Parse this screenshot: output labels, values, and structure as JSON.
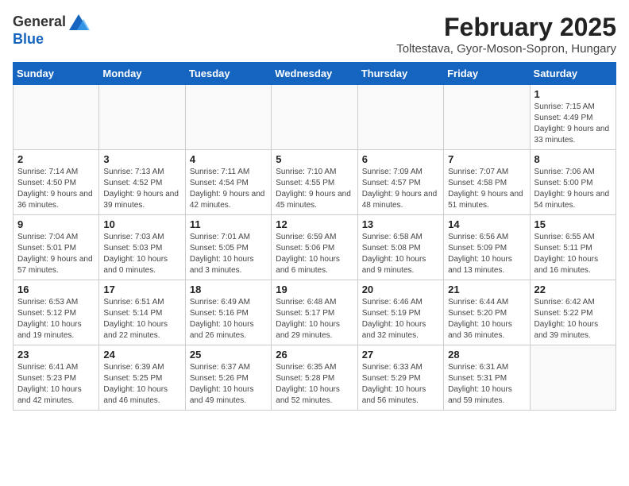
{
  "logo": {
    "general": "General",
    "blue": "Blue"
  },
  "header": {
    "month_year": "February 2025",
    "location": "Toltestava, Gyor-Moson-Sopron, Hungary"
  },
  "weekdays": [
    "Sunday",
    "Monday",
    "Tuesday",
    "Wednesday",
    "Thursday",
    "Friday",
    "Saturday"
  ],
  "weeks": [
    [
      {
        "day": "",
        "info": ""
      },
      {
        "day": "",
        "info": ""
      },
      {
        "day": "",
        "info": ""
      },
      {
        "day": "",
        "info": ""
      },
      {
        "day": "",
        "info": ""
      },
      {
        "day": "",
        "info": ""
      },
      {
        "day": "1",
        "info": "Sunrise: 7:15 AM\nSunset: 4:49 PM\nDaylight: 9 hours and 33 minutes."
      }
    ],
    [
      {
        "day": "2",
        "info": "Sunrise: 7:14 AM\nSunset: 4:50 PM\nDaylight: 9 hours and 36 minutes."
      },
      {
        "day": "3",
        "info": "Sunrise: 7:13 AM\nSunset: 4:52 PM\nDaylight: 9 hours and 39 minutes."
      },
      {
        "day": "4",
        "info": "Sunrise: 7:11 AM\nSunset: 4:54 PM\nDaylight: 9 hours and 42 minutes."
      },
      {
        "day": "5",
        "info": "Sunrise: 7:10 AM\nSunset: 4:55 PM\nDaylight: 9 hours and 45 minutes."
      },
      {
        "day": "6",
        "info": "Sunrise: 7:09 AM\nSunset: 4:57 PM\nDaylight: 9 hours and 48 minutes."
      },
      {
        "day": "7",
        "info": "Sunrise: 7:07 AM\nSunset: 4:58 PM\nDaylight: 9 hours and 51 minutes."
      },
      {
        "day": "8",
        "info": "Sunrise: 7:06 AM\nSunset: 5:00 PM\nDaylight: 9 hours and 54 minutes."
      }
    ],
    [
      {
        "day": "9",
        "info": "Sunrise: 7:04 AM\nSunset: 5:01 PM\nDaylight: 9 hours and 57 minutes."
      },
      {
        "day": "10",
        "info": "Sunrise: 7:03 AM\nSunset: 5:03 PM\nDaylight: 10 hours and 0 minutes."
      },
      {
        "day": "11",
        "info": "Sunrise: 7:01 AM\nSunset: 5:05 PM\nDaylight: 10 hours and 3 minutes."
      },
      {
        "day": "12",
        "info": "Sunrise: 6:59 AM\nSunset: 5:06 PM\nDaylight: 10 hours and 6 minutes."
      },
      {
        "day": "13",
        "info": "Sunrise: 6:58 AM\nSunset: 5:08 PM\nDaylight: 10 hours and 9 minutes."
      },
      {
        "day": "14",
        "info": "Sunrise: 6:56 AM\nSunset: 5:09 PM\nDaylight: 10 hours and 13 minutes."
      },
      {
        "day": "15",
        "info": "Sunrise: 6:55 AM\nSunset: 5:11 PM\nDaylight: 10 hours and 16 minutes."
      }
    ],
    [
      {
        "day": "16",
        "info": "Sunrise: 6:53 AM\nSunset: 5:12 PM\nDaylight: 10 hours and 19 minutes."
      },
      {
        "day": "17",
        "info": "Sunrise: 6:51 AM\nSunset: 5:14 PM\nDaylight: 10 hours and 22 minutes."
      },
      {
        "day": "18",
        "info": "Sunrise: 6:49 AM\nSunset: 5:16 PM\nDaylight: 10 hours and 26 minutes."
      },
      {
        "day": "19",
        "info": "Sunrise: 6:48 AM\nSunset: 5:17 PM\nDaylight: 10 hours and 29 minutes."
      },
      {
        "day": "20",
        "info": "Sunrise: 6:46 AM\nSunset: 5:19 PM\nDaylight: 10 hours and 32 minutes."
      },
      {
        "day": "21",
        "info": "Sunrise: 6:44 AM\nSunset: 5:20 PM\nDaylight: 10 hours and 36 minutes."
      },
      {
        "day": "22",
        "info": "Sunrise: 6:42 AM\nSunset: 5:22 PM\nDaylight: 10 hours and 39 minutes."
      }
    ],
    [
      {
        "day": "23",
        "info": "Sunrise: 6:41 AM\nSunset: 5:23 PM\nDaylight: 10 hours and 42 minutes."
      },
      {
        "day": "24",
        "info": "Sunrise: 6:39 AM\nSunset: 5:25 PM\nDaylight: 10 hours and 46 minutes."
      },
      {
        "day": "25",
        "info": "Sunrise: 6:37 AM\nSunset: 5:26 PM\nDaylight: 10 hours and 49 minutes."
      },
      {
        "day": "26",
        "info": "Sunrise: 6:35 AM\nSunset: 5:28 PM\nDaylight: 10 hours and 52 minutes."
      },
      {
        "day": "27",
        "info": "Sunrise: 6:33 AM\nSunset: 5:29 PM\nDaylight: 10 hours and 56 minutes."
      },
      {
        "day": "28",
        "info": "Sunrise: 6:31 AM\nSunset: 5:31 PM\nDaylight: 10 hours and 59 minutes."
      },
      {
        "day": "",
        "info": ""
      }
    ]
  ]
}
